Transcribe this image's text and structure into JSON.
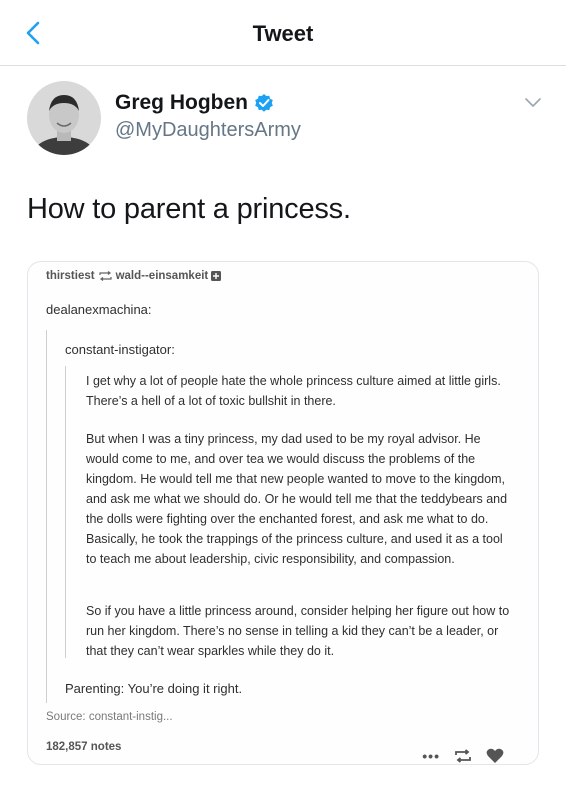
{
  "nav": {
    "title": "Tweet",
    "back_icon": "chevron-left-icon"
  },
  "author": {
    "name": "Greg Hogben",
    "handle": "@MyDaughtersArmy",
    "verified": true
  },
  "tweet": {
    "text": "How to parent a princess."
  },
  "tumblr_post": {
    "reblogger": "thirstiest",
    "source_blog": "wald--einsamkeit",
    "user1": "dealanexmachina:",
    "user2": "constant-instigator:",
    "paragraphs": [
      "I get why a lot of people hate the whole princess culture aimed at little girls. There’s a hell of a lot of toxic bullshit in there.",
      "But when I was a tiny princess, my dad used to be my royal advisor. He would come to me, and over tea we would discuss the problems of the kingdom. He would tell me that new people wanted to move to the kingdom, and ask me what we should do. Or he would tell me that the teddybears and the dolls were fighting over the enchanted forest, and ask me what to do. Basically, he took the trappings of the princess culture, and used it as a tool to teach me about leadership, civic responsibility, and compassion.",
      "So if you have a little princess around, consider helping her figure out how to run her kingdom. There’s no sense in telling a kid they can’t be a leader, or that they can’t wear sparkles while they do it."
    ],
    "closing": "Parenting: You’re doing it right.",
    "source": "Source: constant-instig...",
    "notes": "182,857 notes",
    "more": "•••"
  },
  "colors": {
    "twitter_blue": "#1da1f2",
    "text": "#14171a",
    "muted": "#657786"
  }
}
